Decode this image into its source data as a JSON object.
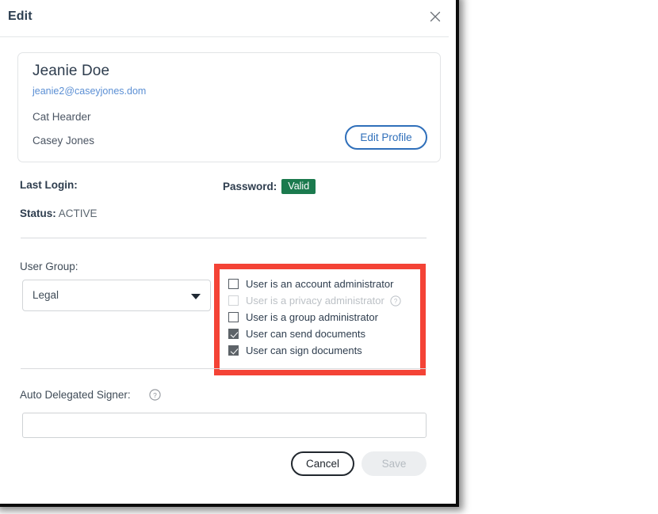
{
  "dialog": {
    "title": "Edit",
    "close_icon": "close-icon"
  },
  "profile": {
    "name": "Jeanie Doe",
    "email": "jeanie2@caseyjones.dom",
    "job_title": "Cat Hearder",
    "company": "Casey Jones",
    "edit_profile_label": "Edit Profile"
  },
  "info": {
    "last_login_label": "Last Login:",
    "last_login_value": "",
    "password_label": "Password:",
    "password_badge": "Valid",
    "password_badge_color": "#1b7a4e",
    "status_label": "Status:",
    "status_value": "ACTIVE"
  },
  "user_group": {
    "label": "User Group:",
    "selected": "Legal",
    "caret_icon": "chevron-down-icon"
  },
  "permissions": {
    "highlight_color": "#f44336",
    "items": [
      {
        "label": "User is an account administrator",
        "checked": false,
        "disabled": false,
        "help": false
      },
      {
        "label": "User is a privacy administrator",
        "checked": false,
        "disabled": true,
        "help": true,
        "help_icon": "help-circle-icon"
      },
      {
        "label": "User is a group administrator",
        "checked": false,
        "disabled": false,
        "help": false
      },
      {
        "label": "User can send documents",
        "checked": true,
        "disabled": false,
        "help": false
      },
      {
        "label": "User can sign documents",
        "checked": true,
        "disabled": false,
        "help": false
      }
    ]
  },
  "auto_delegated_signer": {
    "label": "Auto Delegated Signer:",
    "help_icon": "help-circle-icon",
    "value": "",
    "placeholder": ""
  },
  "footer": {
    "cancel_label": "Cancel",
    "save_label": "Save",
    "save_disabled": true
  }
}
